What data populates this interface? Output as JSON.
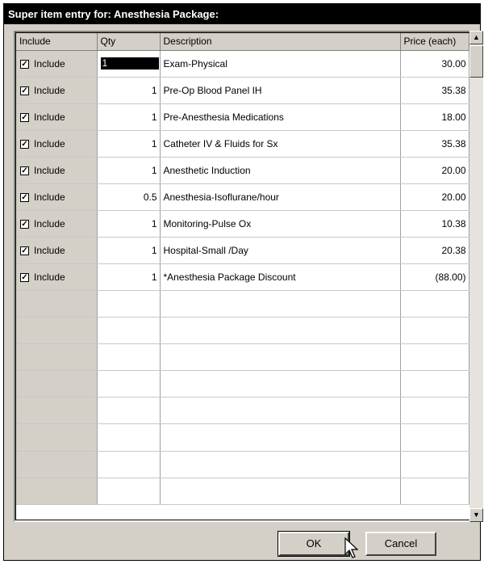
{
  "window": {
    "title": "Super item entry for: Anesthesia Package:"
  },
  "columns": {
    "include": "Include",
    "qty": "Qty",
    "description": "Description",
    "price": "Price (each)"
  },
  "rows": [
    {
      "include": "Include",
      "checked": true,
      "qty": "1",
      "description": "Exam-Physical",
      "price": "30.00"
    },
    {
      "include": "Include",
      "checked": true,
      "qty": "1",
      "description": "Pre-Op Blood Panel IH",
      "price": "35.38"
    },
    {
      "include": "Include",
      "checked": true,
      "qty": "1",
      "description": "Pre-Anesthesia Medications",
      "price": "18.00"
    },
    {
      "include": "Include",
      "checked": true,
      "qty": "1",
      "description": "Catheter IV & Fluids for Sx",
      "price": "35.38"
    },
    {
      "include": "Include",
      "checked": true,
      "qty": "1",
      "description": "Anesthetic Induction",
      "price": "20.00"
    },
    {
      "include": "Include",
      "checked": true,
      "qty": "0.5",
      "description": "Anesthesia-Isoflurane/hour",
      "price": "20.00"
    },
    {
      "include": "Include",
      "checked": true,
      "qty": "1",
      "description": "Monitoring-Pulse Ox",
      "price": "10.38"
    },
    {
      "include": "Include",
      "checked": true,
      "qty": "1",
      "description": "Hospital-Small /Day",
      "price": "20.38"
    },
    {
      "include": "Include",
      "checked": true,
      "qty": "1",
      "description": "*Anesthesia Package Discount",
      "price": "(88.00)"
    }
  ],
  "buttons": {
    "ok": "OK",
    "cancel": "Cancel"
  },
  "icons": {
    "scroll_up": "scroll-up-arrow-icon",
    "scroll_down": "scroll-down-arrow-icon",
    "cursor": "mouse-pointer-icon"
  }
}
